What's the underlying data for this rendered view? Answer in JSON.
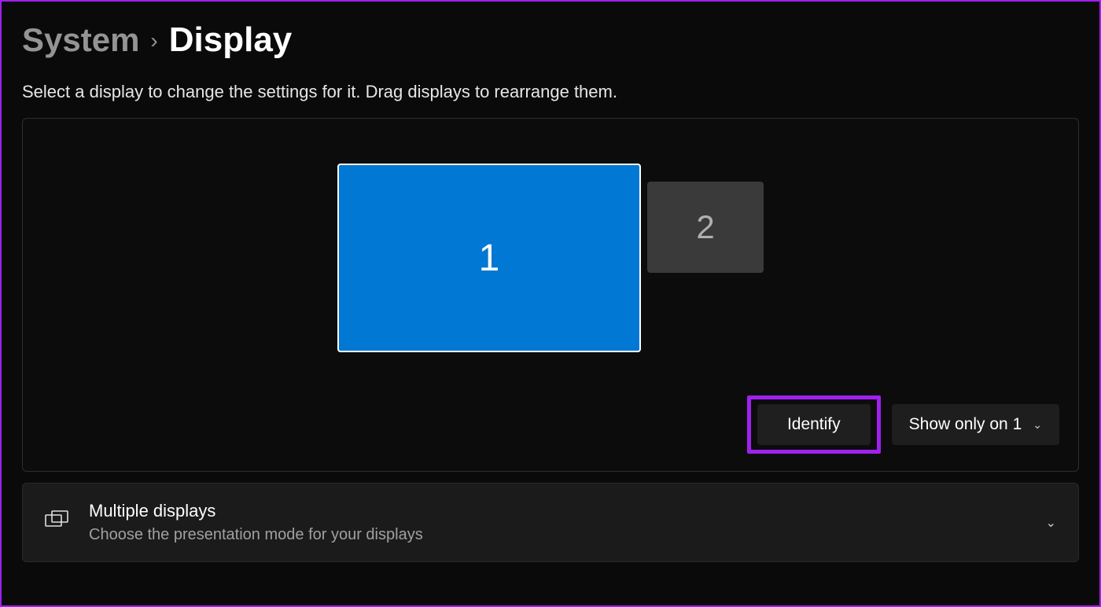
{
  "breadcrumb": {
    "parent": "System",
    "current": "Display"
  },
  "subtitle": "Select a display to change the settings for it. Drag displays to rearrange them.",
  "monitors": {
    "primary_label": "1",
    "secondary_label": "2"
  },
  "controls": {
    "identify_label": "Identify",
    "projection_dropdown": "Show only on 1"
  },
  "multiple_displays_card": {
    "title": "Multiple displays",
    "description": "Choose the presentation mode for your displays"
  }
}
